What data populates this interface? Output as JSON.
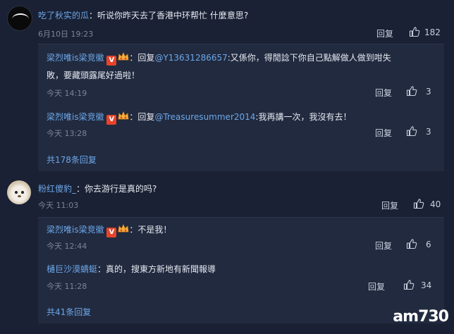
{
  "comments": [
    {
      "username": "吃了秋实的瓜",
      "text": "：听说你昨天去了香港中环帮忙 什麼意思?",
      "time": "6月10日 19:23",
      "reply_label": "回复",
      "likes": "182",
      "replies": [
        {
          "username": "梁烈唯is梁竞徽",
          "badge": "V",
          "prefix": "：回复",
          "mention": "@Y13631286657",
          "text_line1": ":又係你，得閒諗下你自己點解做人做到咁失",
          "text_line2": "敗，要藏頭露尾好過啦！",
          "time": "今天 14:19",
          "reply_label": "回复",
          "likes": "3"
        },
        {
          "username": "梁烈唯is梁竞徽",
          "badge": "V",
          "prefix": "：回复",
          "mention": "@Treasuresummer2014",
          "text_line1": ":我再講一次，我沒有去！",
          "time": "今天 13:28",
          "reply_label": "回复",
          "likes": "3"
        }
      ],
      "more_replies": "共178条回复"
    },
    {
      "username": "粉红傻豹_",
      "text": "：你去游行是真的吗?",
      "time": "今天 11:03",
      "reply_label": "回复",
      "likes": "40",
      "replies": [
        {
          "username": "梁烈唯is梁竞徽",
          "badge": "V",
          "text": "：不是我！",
          "time": "今天 12:44",
          "reply_label": "回复",
          "likes": "6"
        },
        {
          "username": "樋巨沙漠蜻蜓",
          "text": "：真的，搜東方新地有新聞報導",
          "time": "今天 11:28",
          "reply_label": "回复",
          "likes": "34"
        }
      ],
      "more_replies": "共41条回复"
    }
  ],
  "watermark": "am730",
  "colors": {
    "background": "#1a2134",
    "subpanel": "#212a3f",
    "link": "#6da7e8",
    "badge": "#e8432a"
  }
}
